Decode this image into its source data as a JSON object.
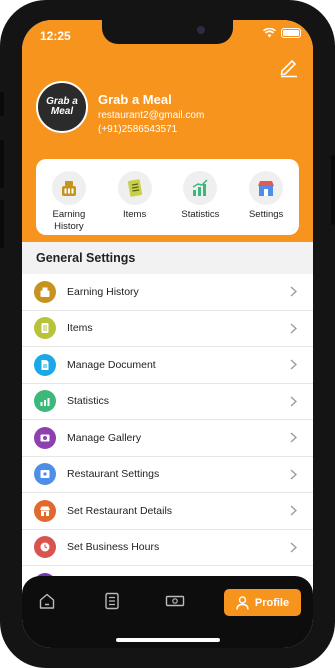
{
  "status_bar": {
    "time": "12:25"
  },
  "profile": {
    "logo_line1": "Grab a",
    "logo_line2": "Meal",
    "name": "Grab a Meal",
    "email": "restaurant2@gmail.com",
    "phone": "(+91)2586543571"
  },
  "quick_actions": [
    {
      "label": "Earning History",
      "icon": "money-bag-icon",
      "color": "#c7931f"
    },
    {
      "label": "Items",
      "icon": "list-icon",
      "color": "#b9c23b"
    },
    {
      "label": "Statistics",
      "icon": "chart-icon",
      "color": "#3bb87a"
    },
    {
      "label": "Settings",
      "icon": "store-icon",
      "color": "#4f8ee8"
    }
  ],
  "section_title": "General Settings",
  "settings_items": [
    {
      "label": "Earning History",
      "icon": "money-bag-icon",
      "color": "#c7931f"
    },
    {
      "label": "Items",
      "icon": "list-icon",
      "color": "#b9c23b"
    },
    {
      "label": "Manage Document",
      "icon": "document-icon",
      "color": "#1aa8e8"
    },
    {
      "label": "Statistics",
      "icon": "chart-icon",
      "color": "#3bb87a"
    },
    {
      "label": "Manage Gallery",
      "icon": "gallery-icon",
      "color": "#8e3fb0"
    },
    {
      "label": "Restaurant Settings",
      "icon": "store-settings-icon",
      "color": "#4f8ee8"
    },
    {
      "label": "Set Restaurant Details",
      "icon": "store-icon",
      "color": "#e06a2c"
    },
    {
      "label": "Set Business Hours",
      "icon": "clock-icon",
      "color": "#d9534f"
    }
  ],
  "bottom_nav": {
    "profile_label": "Profile"
  },
  "colors": {
    "accent": "#f7941d",
    "nav_bg": "#0d0d0d"
  }
}
